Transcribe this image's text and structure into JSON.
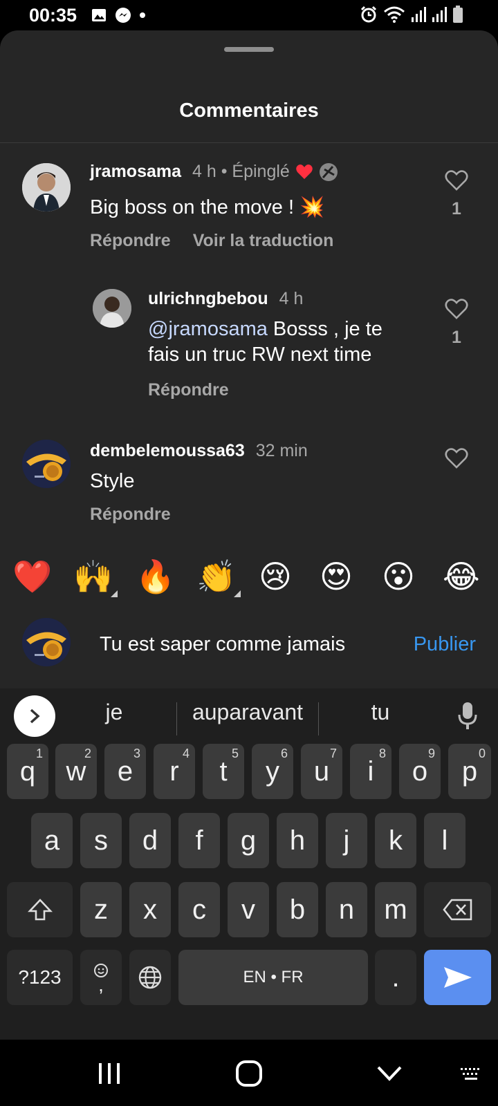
{
  "status_bar": {
    "time": "00:35"
  },
  "sheet": {
    "title": "Commentaires"
  },
  "comments": [
    {
      "username": "jramosama",
      "meta": "4 h • Épinglé",
      "text": "Big boss on the move !",
      "emoji": "💥",
      "reply_label": "Répondre",
      "translate_label": "Voir la traduction",
      "like_count": "1"
    },
    {
      "username": "ulrichngbebou",
      "meta": "4 h",
      "mention": "@jramosama",
      "text_line1": " Bosss , je te",
      "text_line2": "fais un truc RW next time",
      "reply_label": "Répondre",
      "like_count": "1"
    },
    {
      "username": "dembelemoussa63",
      "meta": "32 min",
      "text": "Style",
      "reply_label": "Répondre"
    }
  ],
  "emoji_bar": [
    "❤️",
    "🙌",
    "🔥",
    "👏",
    "😢",
    "😍",
    "😮",
    "😂"
  ],
  "composer": {
    "text": "Tu est saper comme jamais",
    "publish_label": "Publier"
  },
  "keyboard": {
    "suggestions": [
      "je",
      "auparavant",
      "tu"
    ],
    "row1": [
      [
        "q",
        "1"
      ],
      [
        "w",
        "2"
      ],
      [
        "e",
        "3"
      ],
      [
        "r",
        "4"
      ],
      [
        "t",
        "5"
      ],
      [
        "y",
        "6"
      ],
      [
        "u",
        "7"
      ],
      [
        "i",
        "8"
      ],
      [
        "o",
        "9"
      ],
      [
        "p",
        "0"
      ]
    ],
    "row2": [
      "a",
      "s",
      "d",
      "f",
      "g",
      "h",
      "j",
      "k",
      "l"
    ],
    "row3": [
      "z",
      "x",
      "c",
      "v",
      "b",
      "n",
      "m"
    ],
    "symbols_label": "?123",
    "comma_label": ",",
    "space_label": "EN • FR",
    "period_label": "."
  }
}
